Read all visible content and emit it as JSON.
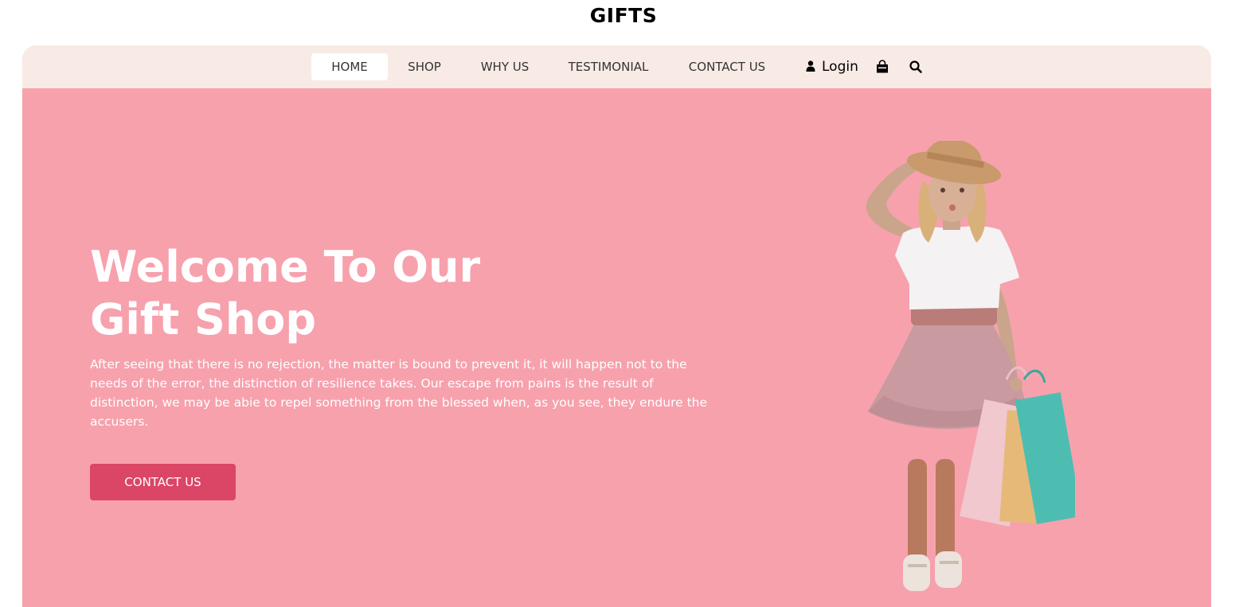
{
  "brand": {
    "title": "GIFTS"
  },
  "nav": {
    "items": [
      {
        "label": "HOME",
        "active": true
      },
      {
        "label": "SHOP",
        "active": false
      },
      {
        "label": "WHY US",
        "active": false
      },
      {
        "label": "TESTIMONIAL",
        "active": false
      },
      {
        "label": "CONTACT US",
        "active": false
      }
    ],
    "login_label": "Login",
    "icons": {
      "login": "user-icon",
      "cart": "shopping-bag-icon",
      "search": "search-icon"
    }
  },
  "hero": {
    "title_line1": "Welcome To Our",
    "title_line2": "Gift Shop",
    "description": "After seeing that there is no rejection, the matter is bound to prevent it, it will happen not to the needs of the error, the distinction of resilience takes. Our escape from pains is the result of distinction, we may be abie to repel something from the blessed when, as you see, they endure the accusers.",
    "cta_label": "CONTACT US",
    "image": "girl-with-shopping-bags-illustration"
  },
  "colors": {
    "hero_background": "#f7a1ad",
    "nav_background": "#f8ebe6",
    "cta_background": "#db4566",
    "text_light": "#ffffff"
  }
}
